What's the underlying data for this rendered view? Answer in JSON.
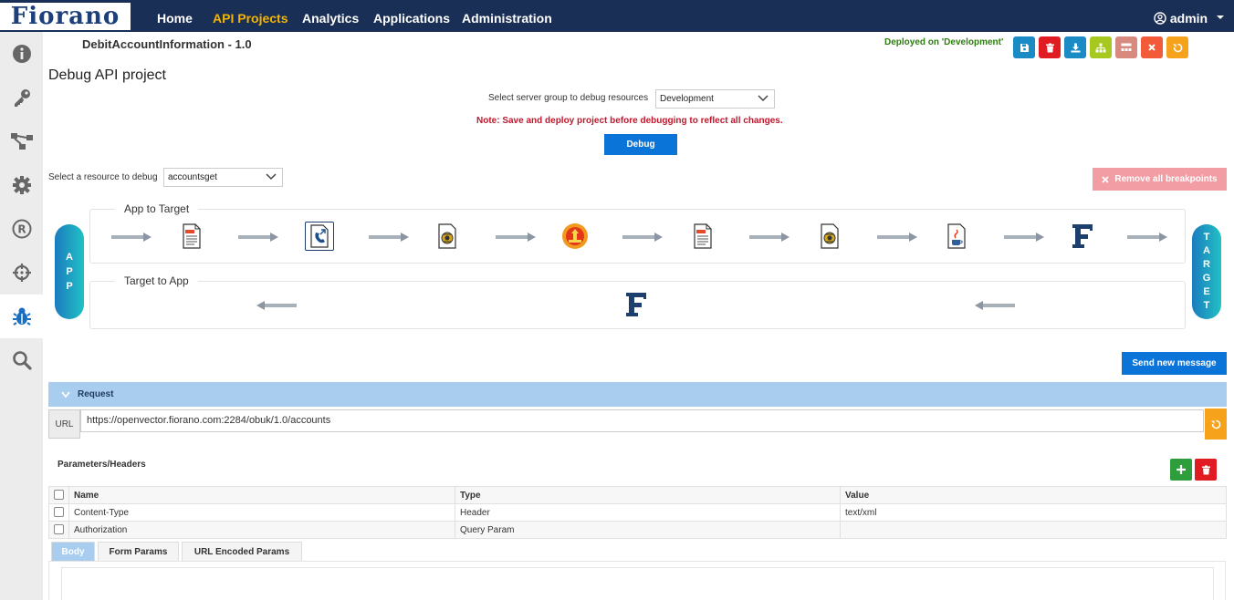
{
  "header": {
    "logo_text": "Fiorano",
    "nav": [
      "Home",
      "API Projects",
      "Analytics",
      "Applications",
      "Administration"
    ],
    "active_nav": "API Projects",
    "user": "admin"
  },
  "sidebar": {
    "items": [
      "info-icon",
      "key-icon",
      "flow-icon",
      "gear-icon",
      "registered-icon",
      "target-icon",
      "bug-icon",
      "search-icon"
    ],
    "active": "bug-icon"
  },
  "project": {
    "title": "DebitAccountInformation - 1.0",
    "deploy_status": "Deployed on 'Development'"
  },
  "toolbar": {
    "buttons": [
      {
        "icon": "save-icon",
        "color": "#1b8bc6"
      },
      {
        "icon": "delete-icon",
        "color": "#e11b22"
      },
      {
        "icon": "download-icon",
        "color": "#1b8bc6"
      },
      {
        "icon": "hierarchy-icon",
        "color": "#a6c81f"
      },
      {
        "icon": "undeploy-icon",
        "color": "#d98a7f"
      },
      {
        "icon": "close-icon",
        "color": "#f25a3a"
      },
      {
        "icon": "refresh-icon",
        "color": "#f7a21b"
      }
    ]
  },
  "debug": {
    "page_title": "Debug API project",
    "server_group_label": "Select server group to debug resources",
    "server_group_value": "Development",
    "note": "Note: Save and deploy project before debugging to reflect all changes.",
    "debug_button": "Debug",
    "resource_label": "Select a resource to debug",
    "resource_value": "accountsget",
    "remove_breakpoints": "Remove all breakpoints"
  },
  "flow": {
    "app_label": "APP",
    "target_label": "TARGET",
    "app_letters": [
      "A",
      "P",
      "P"
    ],
    "target_letters": [
      "T",
      "A",
      "R",
      "G",
      "E",
      "T"
    ],
    "app_to_target_title": "App to Target",
    "target_to_app_title": "Target to App",
    "forward_nodes": [
      "variable-policy-icon",
      "service-callout-icon",
      "script-policy-icon",
      "fault-policy-icon",
      "variable-policy-icon",
      "script-policy-icon",
      "java-policy-icon",
      "fiorano-f-icon"
    ],
    "reverse_nodes": [
      "fiorano-f-icon"
    ]
  },
  "request": {
    "send_button": "Send new message",
    "section_title": "Request",
    "url_label": "URL",
    "url_value": "https://openvector.fiorano.com:2284/obuk/1.0/accounts",
    "params_title": "Parameters/Headers",
    "columns": [
      "Name",
      "Type",
      "Value"
    ],
    "rows": [
      {
        "name": "Content-Type",
        "type": "Header",
        "value": "text/xml"
      },
      {
        "name": "Authorization",
        "type": "Query Param",
        "value": ""
      }
    ],
    "tabs": [
      "Body",
      "Form Params",
      "URL Encoded Params"
    ],
    "active_tab": "Body"
  }
}
